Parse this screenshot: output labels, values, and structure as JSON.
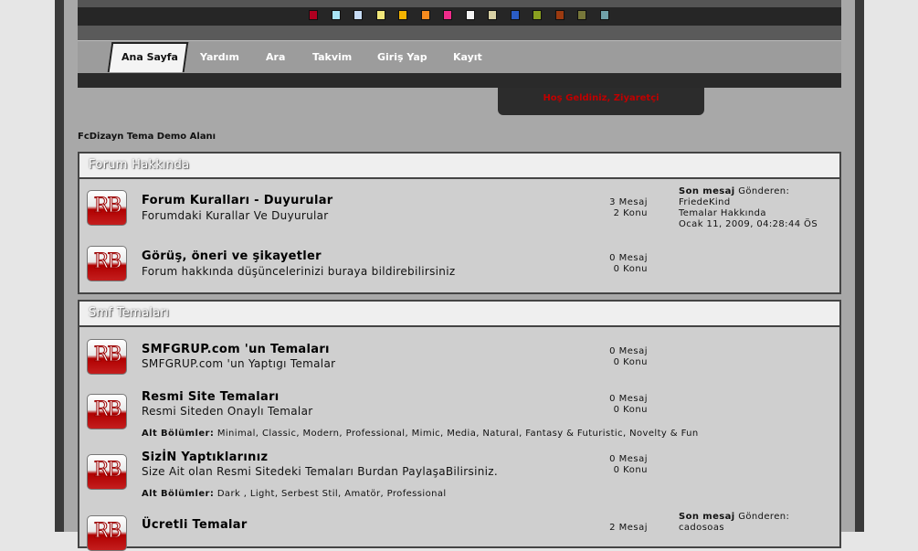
{
  "theme_swatches": [
    "#b00020",
    "#a8e4f5",
    "#c7dcf5",
    "#f1e77a",
    "#f5b400",
    "#f68a1e",
    "#f02b8a",
    "#f4f4f4",
    "#d8d0a4",
    "#2a5cc4",
    "#8aa020",
    "#9b3a10",
    "#77773a",
    "#6fa0a8"
  ],
  "nav": {
    "items": [
      {
        "label": "Ana Sayfa",
        "active": true
      },
      {
        "label": "Yardım"
      },
      {
        "label": "Ara"
      },
      {
        "label": "Takvim"
      },
      {
        "label": "Giriş Yap"
      },
      {
        "label": "Kayıt"
      }
    ]
  },
  "welcome": "Hoş Geldiniz, Ziyaretçi",
  "site_title": "FcDizayn Tema Demo Alanı",
  "categories": [
    {
      "title": "Forum Hakkında",
      "boards": [
        {
          "name": "Forum Kuralları - Duyurular",
          "description": "Forumdaki Kurallar Ve Duyurular",
          "posts": "3 Mesaj",
          "topics": "2 Konu",
          "lastpost": {
            "label": "Son mesaj",
            "by": "Gönderen:",
            "author": "FriedeKind",
            "topic": "Temalar Hakkında",
            "date": "Ocak 11, 2009, 04:28:44 ÖS"
          }
        },
        {
          "name": "Görüş, öneri ve şikayetler",
          "description": "Forum hakkında düşüncelerinizi buraya bildirebilirsiniz",
          "posts": "0 Mesaj",
          "topics": "0 Konu"
        }
      ]
    },
    {
      "title": "Smf Temaları",
      "boards": [
        {
          "name": "SMFGRUP.com 'un Temaları",
          "description": "SMFGRUP.com 'un Yaptıgı Temalar",
          "posts": "0 Mesaj",
          "topics": "0 Konu"
        },
        {
          "name": "Resmi Site Temaları",
          "description": "Resmi Siteden Onaylı Temalar",
          "posts": "0 Mesaj",
          "topics": "0 Konu",
          "children_label": "Alt Bölümler:",
          "children": "Minimal, Classic, Modern, Professional, Mimic, Media, Natural, Fantasy & Futuristic, Novelty & Fun"
        },
        {
          "name": "SizİN Yaptıklarınız",
          "description": "Size Ait olan Resmi Sitedeki Temaları Burdan PaylaşaBilirsiniz.",
          "posts": "0 Mesaj",
          "topics": "0 Konu",
          "children_label": "Alt Bölümler:",
          "children": "Dark , Light, Serbest Stil, Amatör, Professional"
        },
        {
          "name": "Ücretli Temalar",
          "description": "",
          "posts": "2 Mesaj",
          "topics": "",
          "lastpost": {
            "label": "Son mesaj",
            "by": "Gönderen:",
            "author": "cadosoas"
          }
        }
      ]
    }
  ],
  "icon_text": "RB"
}
